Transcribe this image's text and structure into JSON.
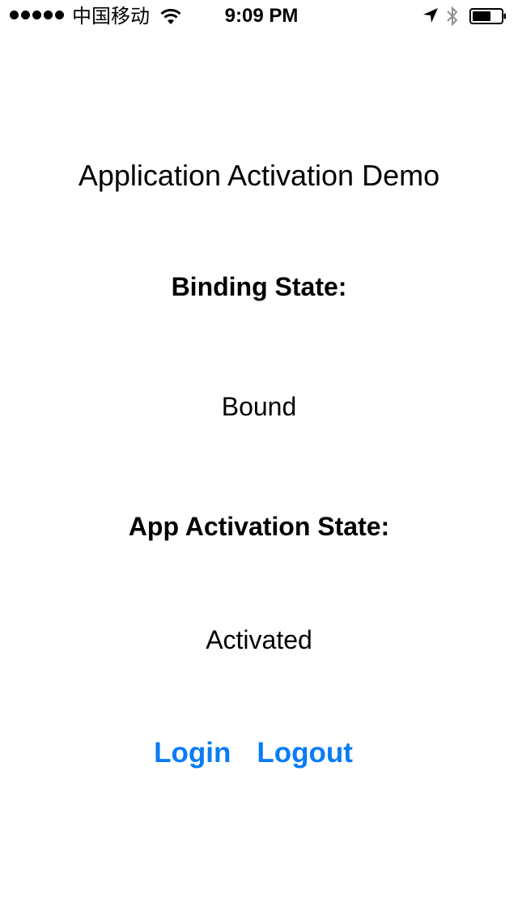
{
  "status_bar": {
    "carrier": "中国移动",
    "time": "9:09 PM",
    "icons": [
      "signal-dots-icon",
      "wifi-icon",
      "location-arrow-icon",
      "bluetooth-icon",
      "battery-icon"
    ]
  },
  "main": {
    "title": "Application Activation Demo",
    "binding_state_label": "Binding State:",
    "binding_state_value": "Bound",
    "activation_state_label": "App Activation State:",
    "activation_state_value": "Activated"
  },
  "actions": {
    "login_label": "Login",
    "logout_label": "Logout"
  },
  "colors": {
    "accent": "#0a7cf5",
    "text": "#000000",
    "background": "#ffffff"
  }
}
